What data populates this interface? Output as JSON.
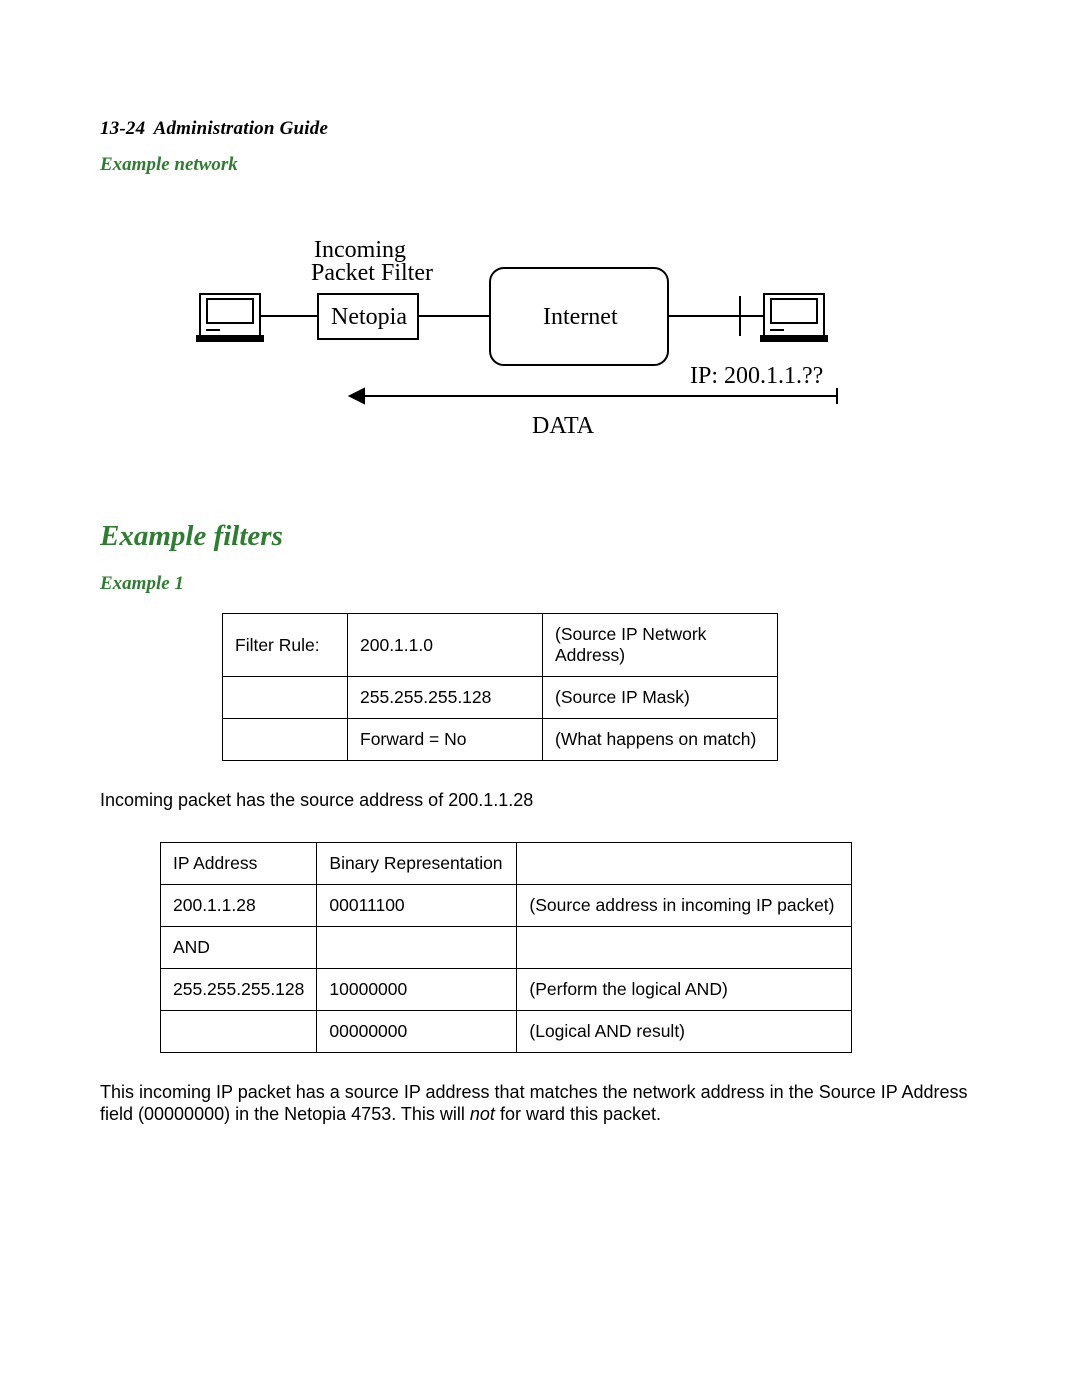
{
  "header": {
    "page_num": "13-24",
    "title": "Administration Guide"
  },
  "section1_title": "Example network",
  "diagram": {
    "label_filter_line1": "Incoming",
    "label_filter_line2": "Packet Filter",
    "box_netopia": "Netopia",
    "box_internet": "Internet",
    "label_ip": "IP: 200.1.1.??",
    "label_data": "DATA"
  },
  "h2": "Example filters",
  "h3": "Example 1",
  "filter_table": {
    "r0": {
      "c0": "Filter Rule:",
      "c1": "200.1.1.0",
      "c2": "(Source IP Network Address)"
    },
    "r1": {
      "c0": "",
      "c1": "255.255.255.128",
      "c2": "(Source IP Mask)"
    },
    "r2": {
      "c0": "",
      "c1": "Forward = No",
      "c2": "(What happens on match)"
    }
  },
  "body1": "Incoming packet has the source address of 200.1.1.28",
  "and_table": {
    "r0": {
      "c0": "IP Address",
      "c1": "Binary Representation",
      "c2": ""
    },
    "r1": {
      "c0": "200.1.1.28",
      "c1": "00011100",
      "c2": "(Source address in incoming IP packet)"
    },
    "r2": {
      "c0": "AND",
      "c1": "",
      "c2": ""
    },
    "r3": {
      "c0": "255.255.255.128",
      "c1": "10000000",
      "c2": "(Perform the logical AND)"
    },
    "r4": {
      "c0": "",
      "c1": "00000000",
      "c2": "(Logical AND result)"
    }
  },
  "body2_a": "This incoming IP packet has a source IP address that matches the network address in the Source IP Address field (00000000) in the Netopia 4753. This will ",
  "body2_ital": "not",
  "body2_b": " for ward this packet."
}
